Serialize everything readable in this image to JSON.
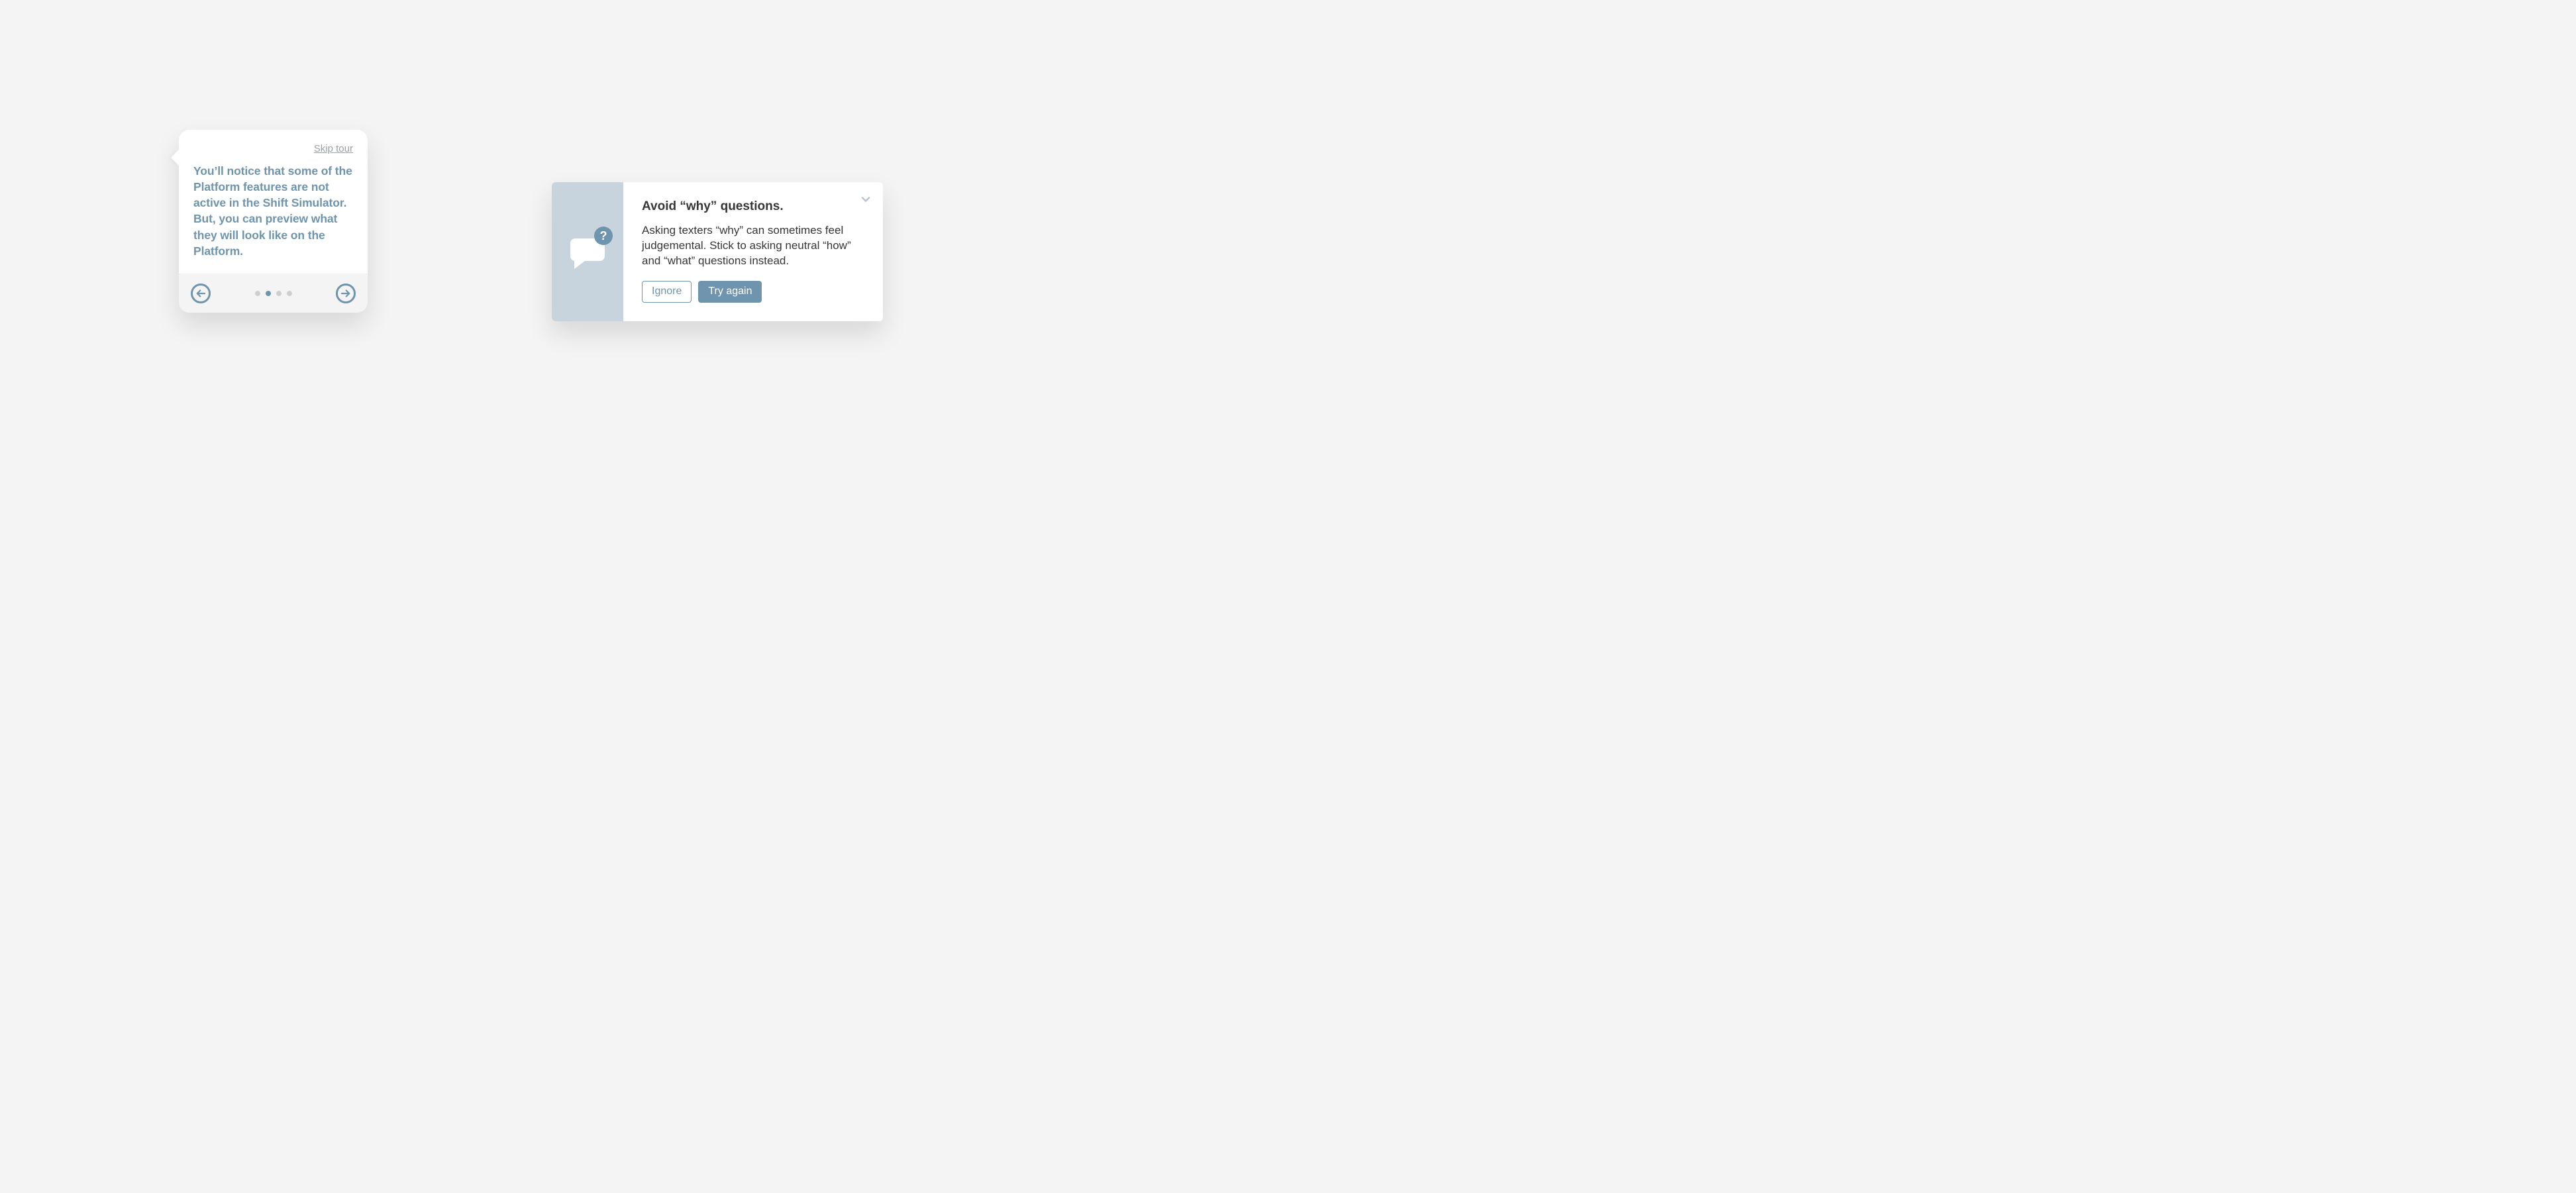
{
  "tour": {
    "skip_label": "Skip tour",
    "body": "You’ll notice that some of the Platform features are not active in the Shift Simulator. But, you can preview what they will look like on the Platform.",
    "pages_total": 4,
    "page_active_index": 1
  },
  "tip": {
    "title": "Avoid “why” questions.",
    "body": "Asking texters “why” can sometimes feel judgemental. Stick to asking neutral “how” and “what” questions instead.",
    "ignore_label": "Ignore",
    "retry_label": "Try again",
    "badge_char": "?"
  },
  "colors": {
    "accent": "#6f94ad",
    "rail": "#c8d4dd",
    "muted": "#9aa0a6"
  }
}
